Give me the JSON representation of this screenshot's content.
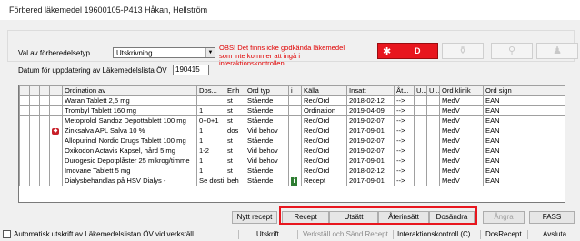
{
  "window": {
    "title": "Förbered läkemedel  19600105-P413 Håkan, Hellström"
  },
  "form": {
    "type_label": "Val av förberedelsetyp",
    "type_value": "Utskrivning",
    "warning": "OBS! Det finns icke godkända läkemedel som inte kommer att ingå i interaktionskontrollen.",
    "d_button_label": "D",
    "date_label": "Datum för uppdatering av Läkemedelslista ÖV",
    "date_value": "190415"
  },
  "table": {
    "columns": [
      "Ordination av",
      "Dos...",
      "Enh",
      "Ord typ",
      "i",
      "Källa",
      "Insatt",
      "Åt...",
      "U...",
      "U...",
      "Ord klinik",
      "Ord sign"
    ],
    "rows": [
      {
        "name": "Waran Tablett 2,5 mg",
        "dose": "",
        "unit": "st",
        "type": "Stående",
        "info": "",
        "source": "Rec/Ord",
        "date": "2018-02-12",
        "at": "-->",
        "clinic": "MedV",
        "sign": "EAN"
      },
      {
        "name": "Trombyl Tablett 160 mg",
        "dose": "1",
        "unit": "st",
        "type": "Stående",
        "info": "",
        "source": "Ordination",
        "date": "2019-04-09",
        "at": "-->",
        "clinic": "MedV",
        "sign": "EAN"
      },
      {
        "name": "Metoprolol Sandoz Depottablett 100 mg",
        "dose": "0+0+1",
        "unit": "st",
        "type": "Stående",
        "info": "",
        "source": "Rec/Ord",
        "date": "2019-02-07",
        "at": "-->",
        "clinic": "MedV",
        "sign": "EAN"
      },
      {
        "name": "Zinksalva APL Salva 10 %",
        "dose": "1",
        "unit": "dos",
        "type": "Vid behov",
        "info": "",
        "source": "Rec/Ord",
        "date": "2017-09-01",
        "at": "-->",
        "clinic": "MedV",
        "sign": "EAN"
      },
      {
        "name": "Allopurinol Nordic Drugs Tablett 100 mg",
        "dose": "1",
        "unit": "st",
        "type": "Stående",
        "info": "",
        "source": "Rec/Ord",
        "date": "2019-02-07",
        "at": "-->",
        "clinic": "MedV",
        "sign": "EAN"
      },
      {
        "name": "Oxikodon Actavis Kapsel, hård 5 mg",
        "dose": "1-2",
        "unit": "st",
        "type": "Vid behov",
        "info": "",
        "source": "Rec/Ord",
        "date": "2019-02-07",
        "at": "-->",
        "clinic": "MedV",
        "sign": "EAN"
      },
      {
        "name": "Durogesic Depotplåster 25 mikrog/timme",
        "dose": "1",
        "unit": "st",
        "type": "Vid behov",
        "info": "",
        "source": "Rec/Ord",
        "date": "2017-09-01",
        "at": "-->",
        "clinic": "MedV",
        "sign": "EAN"
      },
      {
        "name": "Imovane Tablett 5 mg",
        "dose": "1",
        "unit": "st",
        "type": "Stående",
        "info": "",
        "source": "Rec/Ord",
        "date": "2018-02-12",
        "at": "-->",
        "clinic": "MedV",
        "sign": "EAN"
      },
      {
        "name": "Dialysbehandlas på HSV Dialys -",
        "dose": "Se dosti",
        "unit": "beh",
        "type": "Stående",
        "info": "i",
        "source": "Recept",
        "date": "2017-09-01",
        "at": "-->",
        "clinic": "MedV",
        "sign": "EAN"
      }
    ]
  },
  "actions": {
    "nytt_recept": "Nytt recept",
    "recept": "Recept",
    "utsatt": "Utsätt",
    "aterinsatt": "Återinsätt",
    "dosandra": "Dosändra",
    "angra": "Ångra",
    "fass": "FASS"
  },
  "bottom": {
    "auto_print": "Automatisk utskrift av Läkemedelslistan ÖV vid verkställ",
    "utskrift": "Utskrift",
    "verkstall": "Verkställ och Sänd Recept",
    "interaktion": "Interaktionskontroll (C)",
    "dosrecept": "DosRecept",
    "avsluta": "Avsluta"
  },
  "colors": {
    "accent_red": "#e8161e",
    "warning_red": "#e00000",
    "info_green": "#2e7d32"
  }
}
